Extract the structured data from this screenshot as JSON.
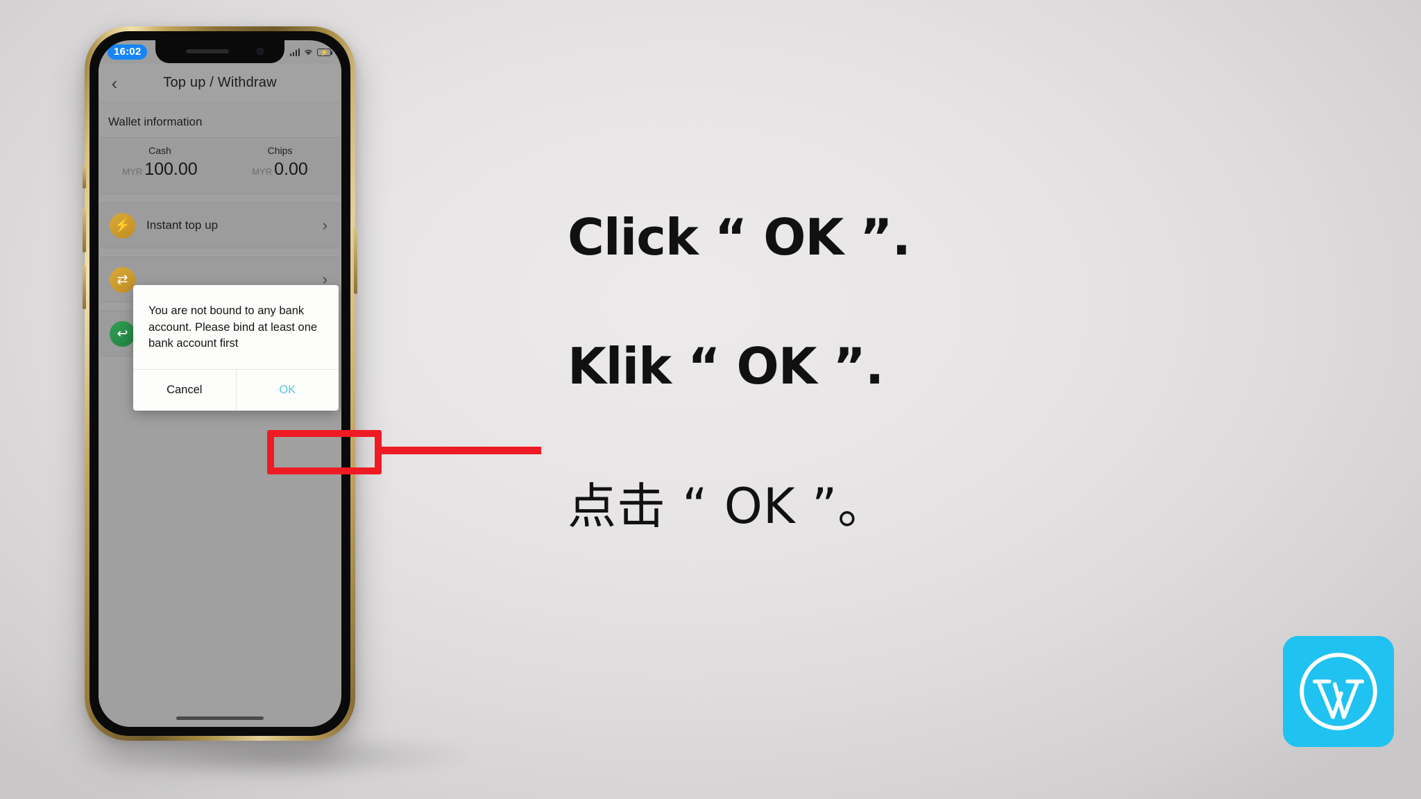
{
  "phone": {
    "statusbar": {
      "time": "16:02",
      "signal_icon": "signal-bars-icon",
      "wifi_icon": "wifi-icon",
      "battery_icon": "battery-charging-icon",
      "battery_bolt": "⚡"
    },
    "navbar": {
      "back_icon": "chevron-left-icon",
      "title": "Top up / Withdraw"
    },
    "section_label": "Wallet information",
    "wallet": {
      "columns": [
        {
          "label": "Cash",
          "currency": "MYR",
          "value": "100.00"
        },
        {
          "label": "Chips",
          "currency": "MYR",
          "value": "0.00"
        }
      ]
    },
    "rows": [
      {
        "icon": "bolt-icon",
        "glyph": "⚡",
        "label": "Instant top up",
        "chevron": "›"
      },
      {
        "icon": "transfer-icon",
        "glyph": "⇄",
        "label": "",
        "chevron": "›"
      },
      {
        "icon": "withdraw-icon",
        "glyph": "↩",
        "label": "",
        "chevron": "›"
      }
    ],
    "alert": {
      "message": "You are not bound to any bank account. Please bind at least one bank account first",
      "cancel_label": "Cancel",
      "ok_label": "OK"
    }
  },
  "annotation": {
    "highlight_color": "#ee1b24",
    "arrow_icon": "pointer-arrow"
  },
  "instructions": {
    "line_en": "Click “ OK ”.",
    "line_id": "Klik “ OK ”.",
    "line_zh": "点击 “ OK ”。"
  },
  "branding": {
    "logo_icon": "wordpress-logo-icon",
    "logo_color": "#1fc2f0"
  }
}
